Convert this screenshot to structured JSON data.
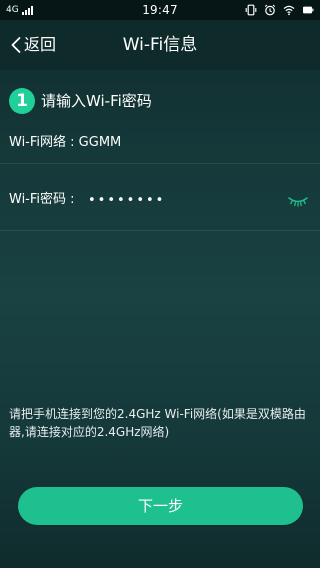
{
  "status_bar": {
    "network_type": "4G",
    "time": "19:47",
    "icons": [
      "signal-icon",
      "vibrate-icon",
      "alarm-icon",
      "wifi-icon",
      "battery-icon"
    ]
  },
  "header": {
    "back_label": "返回",
    "title": "Wi-Fi信息"
  },
  "step": {
    "number": "1",
    "title": "请输入Wi-Fi密码"
  },
  "network": {
    "label": "Wi-Fi网络 : ",
    "value": "GGMM"
  },
  "password": {
    "label": "Wi-Fi密码 :",
    "value": "12345678"
  },
  "hint": "请把手机连接到您的2.4GHz Wi-Fi网络(如果是双模路由器,请连接对应的2.4GHz网络)",
  "next_button_label": "下一步",
  "colors": {
    "accent": "#1fc08f",
    "badge": "#1fd199",
    "background": "#163a3a"
  }
}
